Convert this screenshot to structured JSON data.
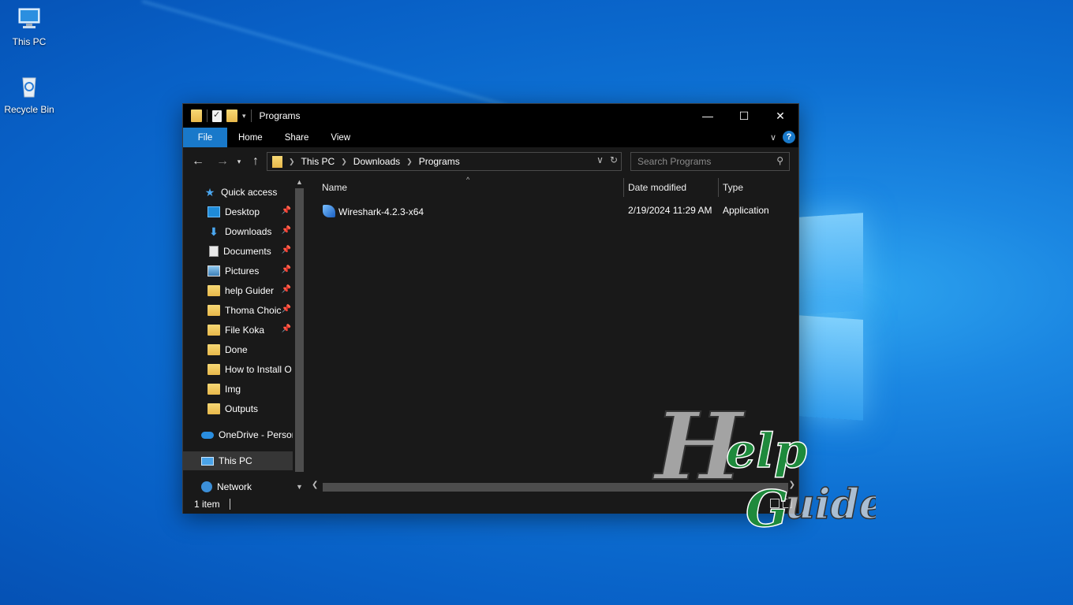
{
  "desktop": {
    "icons": [
      {
        "label": "This PC",
        "icon": "computer-icon"
      },
      {
        "label": "Recycle Bin",
        "icon": "recycle-bin-icon"
      }
    ]
  },
  "window": {
    "title": "Programs",
    "controls": {
      "minimize": "—",
      "maximize": "☐",
      "close": "✕"
    },
    "ribbon": {
      "tabs": [
        "File",
        "Home",
        "Share",
        "View"
      ],
      "help": "?"
    },
    "address": {
      "crumbs": [
        "This PC",
        "Downloads",
        "Programs"
      ]
    },
    "search": {
      "placeholder": "Search Programs"
    },
    "nav_pane": {
      "items": [
        {
          "label": "Quick access",
          "icon": "star-icon",
          "pinned": false
        },
        {
          "label": "Desktop",
          "icon": "desktop-icon",
          "pinned": true
        },
        {
          "label": "Downloads",
          "icon": "download-icon",
          "pinned": true
        },
        {
          "label": "Documents",
          "icon": "document-icon",
          "pinned": true
        },
        {
          "label": "Pictures",
          "icon": "pictures-icon",
          "pinned": true
        },
        {
          "label": "help Guider",
          "icon": "folder-icon",
          "pinned": true
        },
        {
          "label": "Thoma Choic",
          "icon": "folder-icon",
          "pinned": true
        },
        {
          "label": "File Koka",
          "icon": "folder-icon",
          "pinned": true
        },
        {
          "label": "Done",
          "icon": "folder-icon",
          "pinned": false
        },
        {
          "label": "How to Install O",
          "icon": "folder-icon",
          "pinned": false
        },
        {
          "label": "Img",
          "icon": "folder-icon",
          "pinned": false
        },
        {
          "label": "Outputs",
          "icon": "folder-icon",
          "pinned": false
        },
        {
          "label": "OneDrive - Persor",
          "icon": "onedrive-icon",
          "pinned": false
        },
        {
          "label": "This PC",
          "icon": "computer-icon",
          "pinned": false,
          "selected": true
        },
        {
          "label": "Network",
          "icon": "network-icon",
          "pinned": false
        }
      ]
    },
    "columns": [
      "Name",
      "Date modified",
      "Type"
    ],
    "files": [
      {
        "name": "Wireshark-4.2.3-x64",
        "date_modified": "2/19/2024 11:29 AM",
        "type": "Application"
      }
    ],
    "status": {
      "count": "1 item"
    }
  },
  "watermark": {
    "text": "Help Guider"
  },
  "colors": {
    "accent": "#1979ca",
    "window_bg": "#191919",
    "titlebar": "#000000"
  }
}
